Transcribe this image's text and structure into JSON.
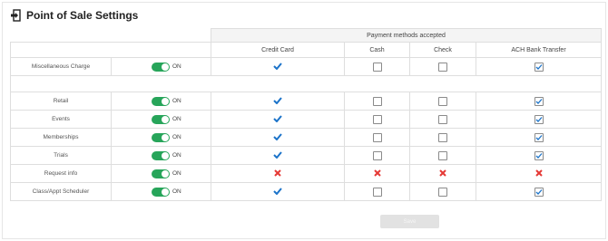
{
  "page": {
    "title": "Point of Sale Settings",
    "icon": "pos-exit-icon"
  },
  "table": {
    "group_header": "Payment methods accepted",
    "columns": [
      "Credit Card",
      "Cash",
      "Check",
      "ACH Bank Transfer"
    ],
    "toggle_text": "ON",
    "rows": [
      {
        "label": "Miscellaneous Charge",
        "toggle": "on",
        "cells": [
          "check-mark",
          "box-empty",
          "box-empty",
          "box-checked"
        ]
      },
      {
        "label": "Retail",
        "toggle": "on",
        "cells": [
          "check-mark",
          "box-empty",
          "box-empty",
          "box-checked"
        ]
      },
      {
        "label": "Events",
        "toggle": "on",
        "cells": [
          "check-mark",
          "box-empty",
          "box-empty",
          "box-checked"
        ]
      },
      {
        "label": "Memberships",
        "toggle": "on",
        "cells": [
          "check-mark",
          "box-empty",
          "box-empty",
          "box-checked"
        ]
      },
      {
        "label": "Trials",
        "toggle": "on",
        "cells": [
          "check-mark",
          "box-empty",
          "box-empty",
          "box-checked"
        ]
      },
      {
        "label": "Request info",
        "toggle": "on",
        "cells": [
          "x-mark",
          "x-mark",
          "x-mark",
          "x-mark"
        ]
      },
      {
        "label": "Class/Appt Scheduler",
        "toggle": "on",
        "cells": [
          "check-mark",
          "box-empty",
          "box-empty",
          "box-checked"
        ]
      }
    ]
  },
  "actions": {
    "save_label": "Save"
  },
  "colors": {
    "toggle_on": "#27a55a",
    "check_blue": "#1b73c9",
    "x_red": "#e53935",
    "button_disabled": "#e2e2e2"
  }
}
